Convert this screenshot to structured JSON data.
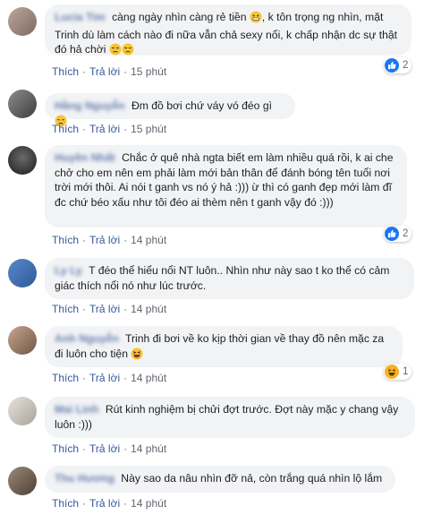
{
  "comments": [
    {
      "author": "Lucia Tim",
      "text": "càng ngày nhìn càng rẻ tiền",
      "text2": ", k tôn trọng ng nhìn, mặt Trinh dù làm cách nào đi nữa vẫn chả sexy nổi, k chấp nhận dc sự thật đó hả chời",
      "like": "Thích",
      "reply": "Trả lời",
      "time": "15 phút",
      "reactions": "2"
    },
    {
      "author": "Hằng Nguyễn",
      "text": "Đm đồ bơi chứ váy vó đéo gì",
      "like": "Thích",
      "reply": "Trả lời",
      "time": "15 phút"
    },
    {
      "author": "Huyền Nhất",
      "text": "Chắc ở quê nhà ngta biết em làm nhiều quá rồi, k ai che chở cho em nên em phải làm mới bản thân để đánh bóng tên tuổi nơi trời mới thôi. Ai nói t ganh vs nó ý hả :))) ừ thì có ganh đẹp mới làm đĩ đc chứ béo xấu như tôi đéo ai thèm nên t ganh vậy đó :)))",
      "like": "Thích",
      "reply": "Trả lời",
      "time": "14 phút",
      "reactions": "2"
    },
    {
      "author": "Ly Ly",
      "text": "T đéo thể hiểu nổi NT luôn.. Nhìn như này sao t ko thể có cảm giác thích nổi nó như lúc trước.",
      "like": "Thích",
      "reply": "Trả lời",
      "time": "14 phút"
    },
    {
      "author": "Anh Nguyễn",
      "text": "Trinh đi bơi về ko kịp thời gian về thay đồ nên mặc za đi luôn cho tiện",
      "like": "Thích",
      "reply": "Trả lời",
      "time": "14 phút",
      "reactions": "1"
    },
    {
      "author": "Mai Linh",
      "text": "Rút kinh nghiệm bị chửi đợt trước. Đợt này mặc y chang vậy luôn :)))",
      "like": "Thích",
      "reply": "Trả lời",
      "time": "14 phút"
    },
    {
      "author": "Thu Hương",
      "text": "Này sao da nâu nhìn đỡ nả, còn trắng quá nhìn lộ lắm",
      "like": "Thích",
      "reply": "Trả lời",
      "time": "14 phút"
    }
  ]
}
